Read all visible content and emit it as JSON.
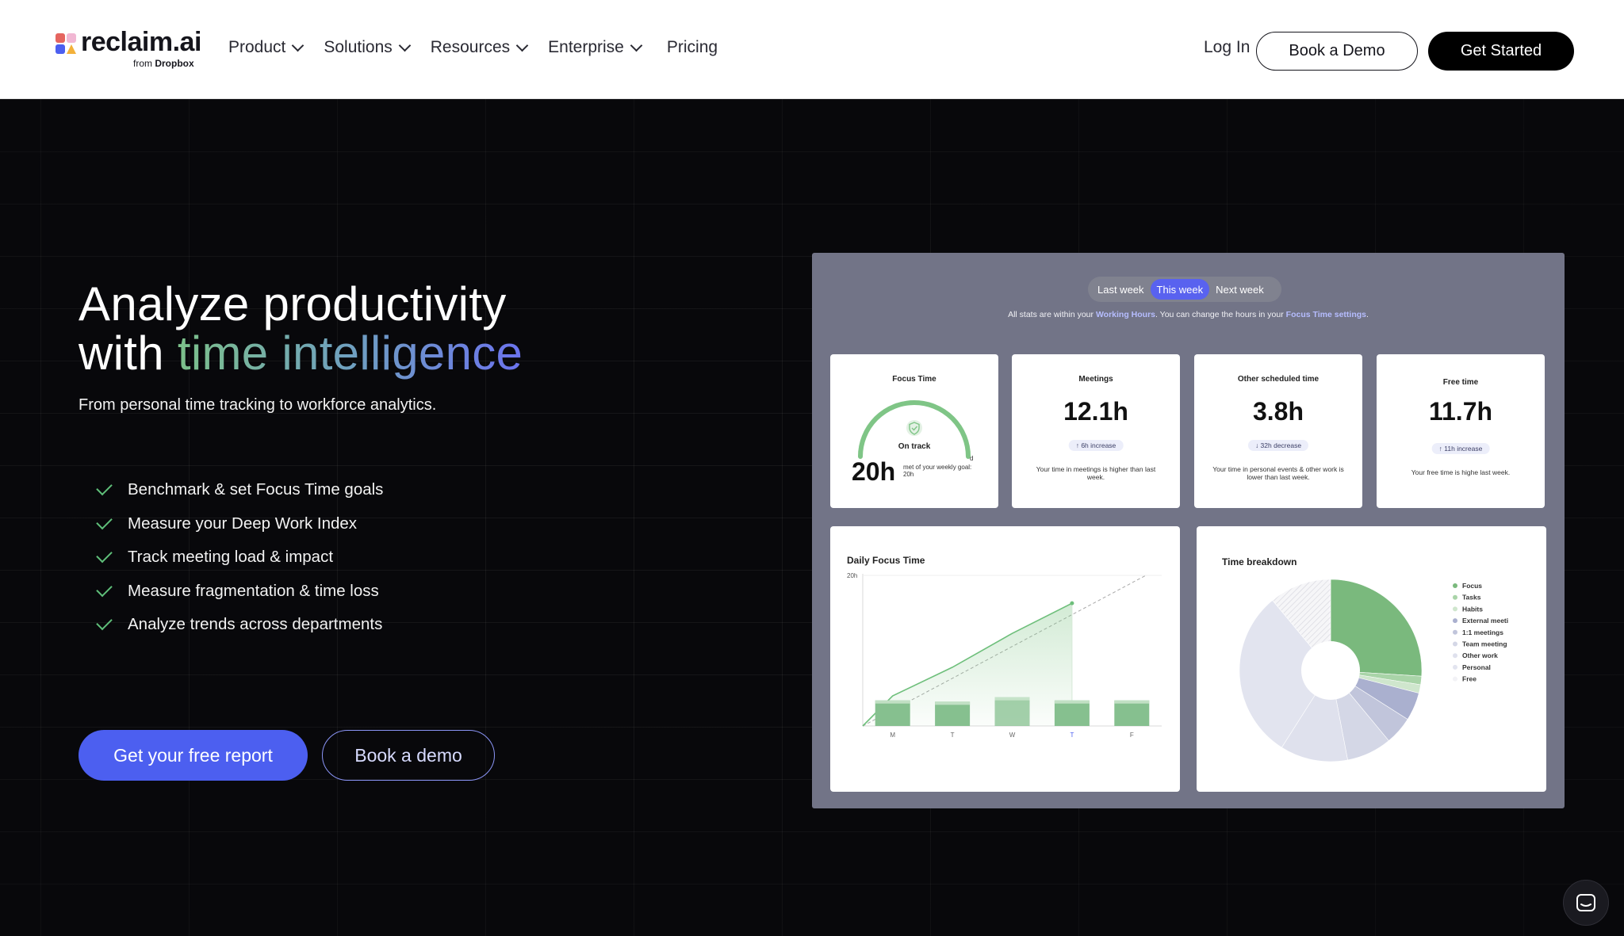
{
  "nav": {
    "logo_text": "reclaim.ai",
    "logo_sub_prefix": "from",
    "logo_sub_brand": "Dropbox",
    "items": [
      {
        "label": "Product"
      },
      {
        "label": "Solutions"
      },
      {
        "label": "Resources"
      },
      {
        "label": "Enterprise"
      }
    ],
    "pricing": "Pricing",
    "login": "Log In",
    "book_demo": "Book a Demo",
    "get_started": "Get Started"
  },
  "hero": {
    "title_line1": "Analyze productivity",
    "title_line2_prefix": "with",
    "title_line2_highlight": "time intelligence",
    "subtitle": "From personal time tracking to workforce analytics.",
    "features": [
      "Benchmark & set Focus Time goals",
      "Measure your Deep Work Index",
      "Track meeting load & impact",
      "Measure fragmentation & time loss",
      "Analyze trends across departments"
    ],
    "cta_primary": "Get your free report",
    "cta_secondary": "Book a demo"
  },
  "dashboard": {
    "week_tabs": [
      "Last week",
      "This week",
      "Next week"
    ],
    "active_week": "This week",
    "hint_prefix": "All stats are within your",
    "hint_link1": "Working Hours",
    "hint_middle": ". You can change the hours in your",
    "hint_link2": "Focus Time settings",
    "hint_suffix": ".",
    "focus": {
      "title": "Focus Time",
      "status": "On track",
      "value": "20h",
      "sub": "met of your weekly goal: 20h",
      "gauge_fraction": 1.0
    },
    "meetings": {
      "title": "Meetings",
      "value": "12.1h",
      "pill": "↑ 6h increase",
      "desc": "Your time in meetings is higher than last week."
    },
    "other": {
      "title": "Other scheduled time",
      "value": "3.8h",
      "pill": "↓ 32h decrease",
      "desc": "Your time in personal events & other work is lower than last week."
    },
    "free": {
      "title": "Free time",
      "value": "11.7h",
      "pill": "↑ 11h increase",
      "desc": "Your free time is highe last week."
    }
  },
  "chart_data": [
    {
      "type": "bar",
      "title": "Daily Focus Time",
      "categories": [
        "M",
        "T",
        "W",
        "T",
        "F"
      ],
      "values": [
        4,
        3.8,
        4.5,
        4,
        4
      ],
      "cumulative": [
        4,
        7.8,
        12.3,
        16.3
      ],
      "y_tick_label": "20h",
      "ylim": [
        0,
        20
      ],
      "highlight_category_index": 3,
      "colors": {
        "bar": "#86c08f",
        "line": "#6ebf7b",
        "target": "#a8a8a8",
        "highlight_tick": "#4c5ff0"
      }
    },
    {
      "type": "pie",
      "title": "Time breakdown",
      "legend": [
        "Focus",
        "Tasks",
        "Habits",
        "External meeti",
        "1:1 meetings",
        "Team meeting",
        "Other work",
        "Personal",
        "Free"
      ],
      "legend_placement": "right",
      "slices": [
        {
          "label": "Focus",
          "value": 26,
          "color": "#7ab97d"
        },
        {
          "label": "Tasks",
          "value": 1.5,
          "color": "#a9d4a8"
        },
        {
          "label": "Habits",
          "value": 1.5,
          "color": "#cfe6cd"
        },
        {
          "label": "External meeti",
          "value": 5,
          "color": "#aab0cf"
        },
        {
          "label": "1:1 meetings",
          "value": 5,
          "color": "#c1c5db"
        },
        {
          "label": "Team meeting",
          "value": 8,
          "color": "#d4d7e6"
        },
        {
          "label": "Other work",
          "value": 12,
          "color": "#dfe1ed"
        },
        {
          "label": "Personal",
          "value": 30,
          "color": "#e2e4ef"
        },
        {
          "label": "Free",
          "value": 11,
          "color": "#f2f2f6"
        }
      ]
    }
  ]
}
